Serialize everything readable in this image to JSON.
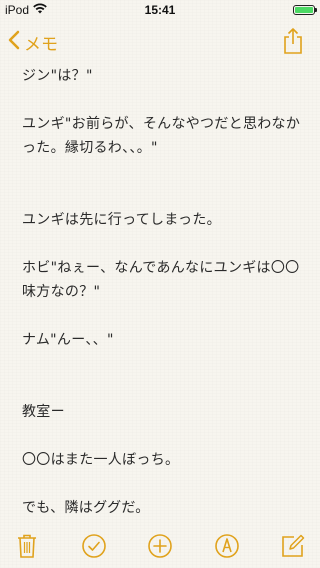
{
  "status_bar": {
    "carrier": "iPod",
    "time": "15:41",
    "battery_percent": 100,
    "battery_color": "#4cd964"
  },
  "nav": {
    "back_label": "メモ",
    "back_icon": "chevron-left-icon",
    "share_icon": "share-icon",
    "accent_color": "#e0a21c"
  },
  "note": {
    "lines": [
      "ジン\"は？\"",
      "",
      "ユンギ\"お前らが、そんなやつだと思わなかった。縁切るわ、、。\"",
      "",
      "",
      "ユンギは先に行ってしまった。",
      "",
      "ホビ\"ねぇー、なんであんなにユンギは〇〇味方なの？\"",
      "",
      "ナム\"んー、、\"",
      "",
      "",
      "教室ー",
      "",
      "〇〇はまた一人ぼっち。",
      "",
      "でも、隣はググだ。"
    ]
  },
  "toolbar": {
    "items": [
      {
        "icon": "trash-icon"
      },
      {
        "icon": "checklist-icon"
      },
      {
        "icon": "add-icon"
      },
      {
        "icon": "markup-pen-icon"
      },
      {
        "icon": "compose-icon"
      }
    ]
  }
}
